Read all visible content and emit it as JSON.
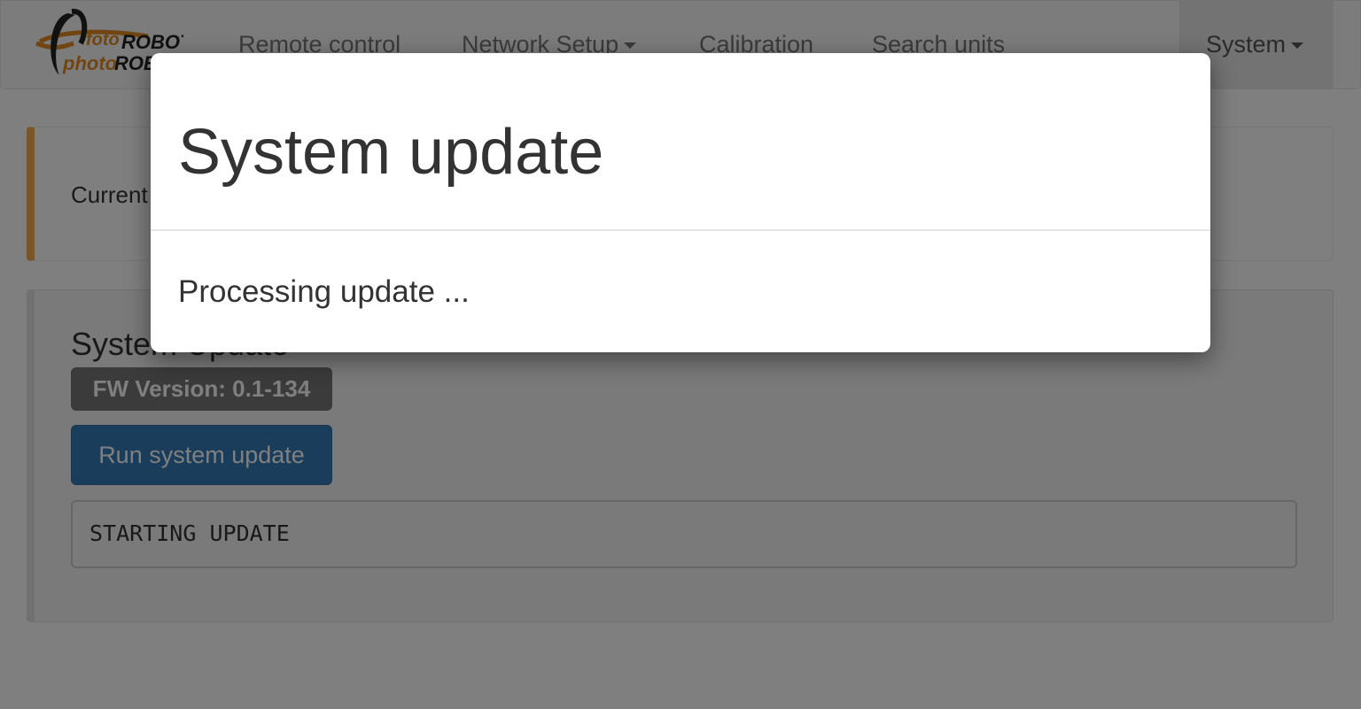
{
  "navbar": {
    "logo_alt": "fotoROBOT photoROBOT",
    "logo_text_top": "fotoROBOT",
    "logo_text_bottom": "photoROBOT",
    "links": {
      "remote_control": "Remote control",
      "network_setup": "Network Setup",
      "calibration": "Calibration",
      "search_units": "Search units",
      "system": "System"
    },
    "colors": {
      "background": "#f8f8f8",
      "active": "#e7e7e7",
      "link": "#777777"
    }
  },
  "callout": {
    "text": "Current"
  },
  "system_panel": {
    "title": "System Update",
    "fw_badge": "FW Version: 0.1-134",
    "run_button": "Run system update",
    "log_output": "STARTING UPDATE"
  },
  "modal": {
    "title": "System update",
    "body": "Processing update ..."
  },
  "theme": {
    "primary": "#337ab7",
    "warning_accent": "#f0ad4e",
    "badge_default": "#777777",
    "backdrop": "rgba(0,0,0,0.5)"
  },
  "icons": {
    "logo": "photorobot-logo",
    "dropdown": "caret-down-icon"
  }
}
